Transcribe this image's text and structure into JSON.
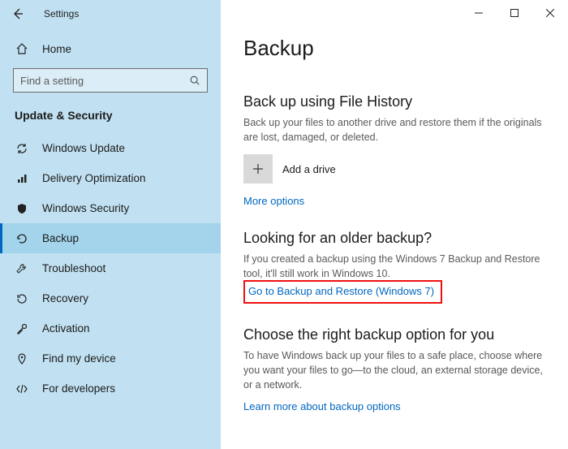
{
  "titlebar": {
    "title": "Settings"
  },
  "sidebar": {
    "home_label": "Home",
    "search_placeholder": "Find a setting",
    "section_header": "Update & Security",
    "items": [
      {
        "label": "Windows Update"
      },
      {
        "label": "Delivery Optimization"
      },
      {
        "label": "Windows Security"
      },
      {
        "label": "Backup"
      },
      {
        "label": "Troubleshoot"
      },
      {
        "label": "Recovery"
      },
      {
        "label": "Activation"
      },
      {
        "label": "Find my device"
      },
      {
        "label": "For developers"
      }
    ]
  },
  "main": {
    "page_title": "Backup",
    "fh_heading": "Back up using File History",
    "fh_desc": "Back up your files to another drive and restore them if the originals are lost, damaged, or deleted.",
    "add_drive_label": "Add a drive",
    "more_options": "More options",
    "older_heading": "Looking for an older backup?",
    "older_desc": "If you created a backup using the Windows 7 Backup and Restore tool, it'll still work in Windows 10.",
    "older_link": "Go to Backup and Restore (Windows 7)",
    "choose_heading": "Choose the right backup option for you",
    "choose_desc": "To have Windows back up your files to a safe place, choose where you want your files to go—to the cloud, an external storage device, or a network.",
    "choose_link": "Learn more about backup options"
  }
}
